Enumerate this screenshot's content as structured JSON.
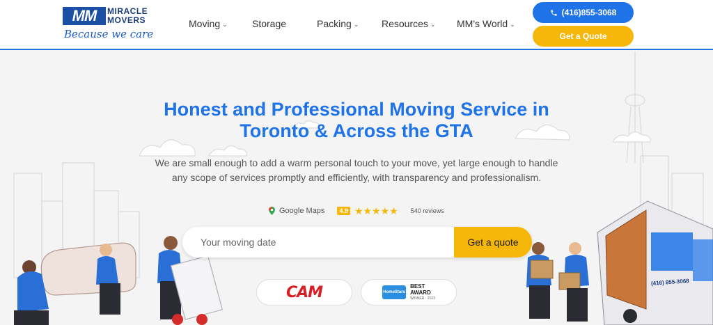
{
  "header": {
    "logo": {
      "mark": "MM",
      "line1": "MIRACLE",
      "line2": "MOVERS",
      "tagline": "Because we care"
    },
    "nav": [
      {
        "label": "Moving",
        "dropdown": true
      },
      {
        "label": "Storage",
        "dropdown": false
      },
      {
        "label": "Packing",
        "dropdown": true
      },
      {
        "label": "Resources",
        "dropdown": true
      },
      {
        "label": "MM's World",
        "dropdown": true
      }
    ],
    "phone_label": "(416)855-3068",
    "quote_label": "Get a Quote"
  },
  "hero": {
    "title_line1": "Honest and Professional Moving Service in",
    "title_line2": "Toronto & Across the GTA",
    "subtitle": "We are small enough to add a warm personal touch to your move, yet large enough to handle any scope of services promptly and efficiently, with transparency and professionalism."
  },
  "rating": {
    "source": "Google Maps",
    "score": "4.9",
    "stars": "★★★★★",
    "reviews": "540 reviews"
  },
  "search": {
    "placeholder": "Your moving date",
    "button": "Get a quote"
  },
  "badges": {
    "cam": "CAM",
    "homestars_logo": "HomeStars",
    "homestars_award_line1": "BEST",
    "homestars_award_line2": "AWARD",
    "homestars_award_line3": "WINNER · 2023"
  },
  "truck": {
    "phone": "(416) 855-3068"
  },
  "colors": {
    "primary": "#1e73e8",
    "accent": "#f6b70b",
    "logo_blue": "#1a4fa3",
    "cam_red": "#d81f26"
  },
  "icons": [
    "phone-icon",
    "chevron-down-icon",
    "google-maps-pin-icon",
    "star-icon"
  ]
}
